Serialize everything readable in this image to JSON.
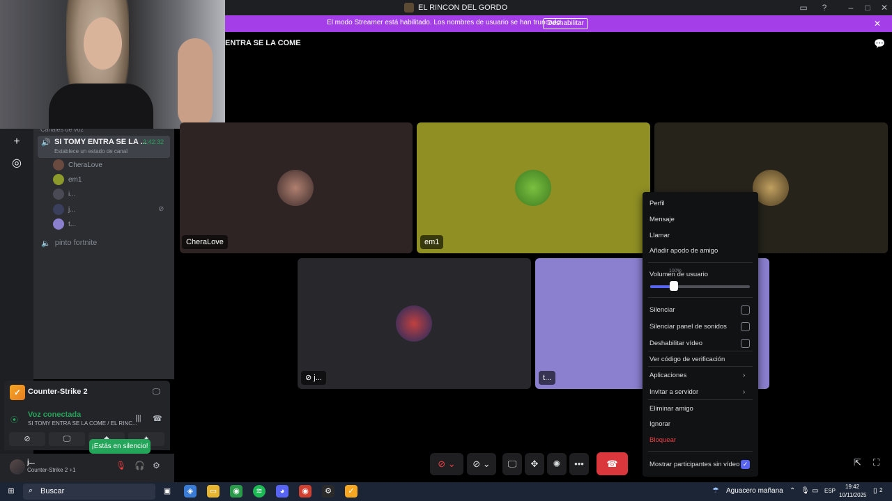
{
  "window": {
    "title": "EL RINCON DEL GORDO"
  },
  "banner": {
    "text": "El modo Streamer está habilitado. Los nombres de usuario se han truncado.",
    "button": "Deshabilitar"
  },
  "sidebar": {
    "category": "Canales de voz",
    "active_channel": {
      "name": "SI TOMY ENTRA SE LA ...",
      "time": "2:42:32",
      "status": "Establece un estado de canal"
    },
    "members": [
      {
        "name": "CheraLove",
        "color": "#6b4a40"
      },
      {
        "name": "em1",
        "color": "#8b9a2a"
      },
      {
        "name": "i...",
        "color": "#4a4a55"
      },
      {
        "name": "j...",
        "color": "#3a3f5c"
      },
      {
        "name": "t...",
        "color": "#8b7fd0"
      }
    ],
    "other_channel": "pinto fortnite"
  },
  "activity": {
    "game": "Counter-Strike 2"
  },
  "voice": {
    "status": "Voz conectada",
    "channel_path": "SI TOMY ENTRA SE LA COME / EL RINC..."
  },
  "tooltip": "¡Estás en silencio!",
  "user": {
    "name": "j...",
    "status": "Counter-Strike 2 +1"
  },
  "stage": {
    "title": "ENTRA SE LA COME",
    "tiles": [
      {
        "label": "CheraLove",
        "bg": "#2f2424"
      },
      {
        "label": "em1",
        "bg": "#8f8f24"
      },
      {
        "label": "",
        "bg": "#26241a"
      },
      {
        "label": "j...",
        "bg": "#28272c"
      },
      {
        "label": "t...",
        "bg": "#8b7fd0"
      }
    ]
  },
  "context_menu": {
    "items": [
      "Perfil",
      "Mensaje",
      "Llamar",
      "Añadir apodo de amigo"
    ],
    "volume_label": "Volumen de usuario",
    "volume_value": 0.24,
    "volume_percent": "100%",
    "checkbox_items": [
      "Silenciar",
      "Silenciar panel de sonidos",
      "Deshabilitar vídeo"
    ],
    "verify": "Ver código de verificación",
    "submenu_items": [
      "Aplicaciones",
      "Invitar a servidor"
    ],
    "more_items": [
      "Eliminar amigo",
      "Ignorar"
    ],
    "danger_item": "Bloquear",
    "show_no_video": "Mostrar participantes sin vídeo"
  },
  "taskbar": {
    "search": "Buscar",
    "weather": "Aguacero mañana",
    "lang": "ESP",
    "time": "19:42",
    "date": "10/11/2025",
    "notifications": "2"
  }
}
